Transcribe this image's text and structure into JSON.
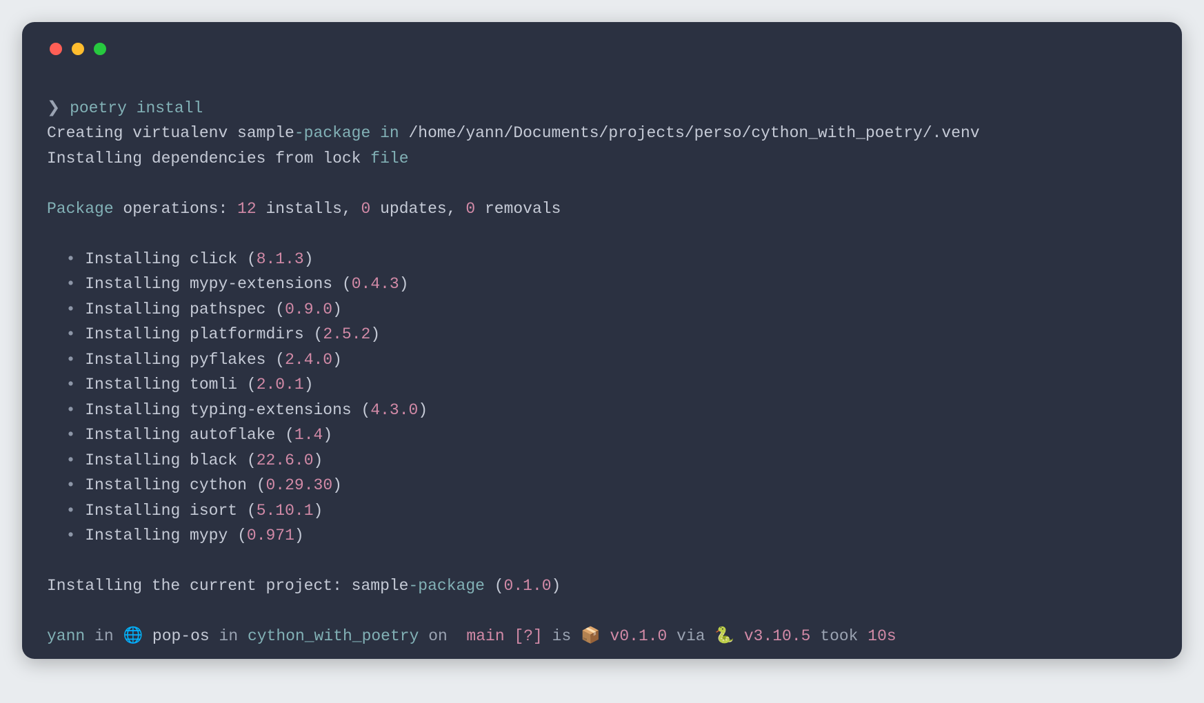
{
  "command": "poetry install",
  "venv_line": {
    "prefix": "Creating virtualenv sample",
    "dash_pkg": "-package",
    "in_word": " in ",
    "path": "/home/yann/Documents/projects/perso/cython_with_poetry/.venv"
  },
  "lockfile_line": {
    "prefix": "Installing dependencies from lock ",
    "file_word": "file"
  },
  "ops_line": {
    "package_word": "Package",
    "middle": " operations: ",
    "installs": "12",
    "between_1": " installs, ",
    "updates": "0",
    "between_2": " updates, ",
    "removals": "0",
    "tail": " removals"
  },
  "packages": [
    {
      "name": "click",
      "version": "8.1.3"
    },
    {
      "name": "mypy-extensions",
      "version": "0.4.3"
    },
    {
      "name": "pathspec",
      "version": "0.9.0"
    },
    {
      "name": "platformdirs",
      "version": "2.5.2"
    },
    {
      "name": "pyflakes",
      "version": "2.4.0"
    },
    {
      "name": "tomli",
      "version": "2.0.1"
    },
    {
      "name": "typing-extensions",
      "version": "4.3.0"
    },
    {
      "name": "autoflake",
      "version": "1.4"
    },
    {
      "name": "black",
      "version": "22.6.0"
    },
    {
      "name": "cython",
      "version": "0.29.30"
    },
    {
      "name": "isort",
      "version": "5.10.1"
    },
    {
      "name": "mypy",
      "version": "0.971"
    }
  ],
  "current_project": {
    "prefix": "Installing the current project: sample",
    "dash_pkg": "-package",
    "version": "0.1.0"
  },
  "prompt": {
    "user": "yann",
    "host": "pop-os",
    "dir": "cython_with_poetry",
    "branch": "main",
    "status": "[?]",
    "pkg_version": "v0.1.0",
    "py_version": "v3.10.5",
    "took": "10s",
    "globe_icon": "🌐",
    "branch_icon": "",
    "box_icon": "📦",
    "snake_icon": "🐍"
  }
}
